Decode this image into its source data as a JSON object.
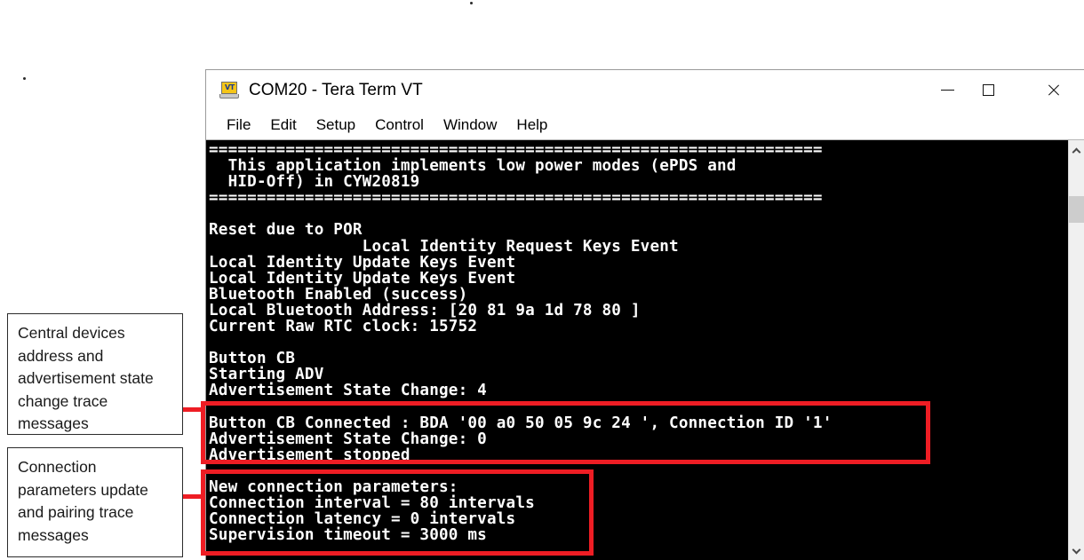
{
  "window": {
    "title": "COM20 - Tera Term VT",
    "app_icon": "tera-term-vt-icon",
    "icon_label": "VT",
    "controls": {
      "minimize": "minimize-icon",
      "maximize": "maximize-icon",
      "close": "close-icon"
    },
    "menu": [
      {
        "label": "File"
      },
      {
        "label": "Edit"
      },
      {
        "label": "Setup"
      },
      {
        "label": "Control"
      },
      {
        "label": "Window"
      },
      {
        "label": "Help"
      }
    ]
  },
  "terminal": {
    "lines": [
      "================================================================",
      "  This application implements low power modes (ePDS and",
      "  HID-Off) in CYW20819",
      "================================================================",
      "",
      "Reset due to POR",
      "                Local Identity Request Keys Event",
      "Local Identity Update Keys Event",
      "Local Identity Update Keys Event",
      "Bluetooth Enabled (success)",
      "Local Bluetooth Address: [20 81 9a 1d 78 80 ]",
      "Current Raw RTC clock: 15752",
      "",
      "Button CB",
      "Starting ADV",
      "Advertisement State Change: 4",
      "",
      "Button CB Connected : BDA '00 a0 50 05 9c 24 ', Connection ID '1'",
      "Advertisement State Change: 0",
      "Advertisement stopped",
      "",
      "New connection parameters:",
      "Connection interval = 80 intervals",
      "Connection latency = 0 intervals",
      "Supervision timeout = 3000 ms"
    ]
  },
  "annotations": {
    "highlight_color": "#ee1d24",
    "callout_1": {
      "lines": [
        "Central devices",
        "address and",
        "advertisement state",
        "change trace",
        " messages"
      ]
    },
    "callout_2": {
      "lines": [
        "Connection",
        "parameters update",
        "and pairing trace",
        "messages"
      ]
    }
  },
  "scrollbar": {
    "up_icon": "chevron-up-icon",
    "down_icon": "chevron-down-icon"
  }
}
